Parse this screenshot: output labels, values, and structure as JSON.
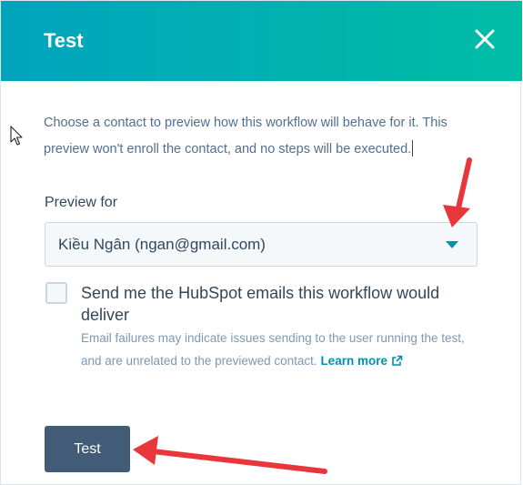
{
  "dialog": {
    "title": "Test",
    "close_icon": "close-icon"
  },
  "description": "Choose a contact to preview how this workflow will behave for it. This preview won't enroll the contact, and no steps will be executed.",
  "preview": {
    "label": "Preview for",
    "selected": "Kiều Ngân (ngan@gmail.com)",
    "dropdown_icon": "caret-down-icon"
  },
  "send_emails": {
    "checked": false,
    "label": "Send me the HubSpot emails this workflow would deliver",
    "help": "Email failures may indicate issues sending to the user running the test, and are unrelated to the previewed contact.",
    "learn_more": "Learn more",
    "learn_more_icon": "external-link-icon"
  },
  "actions": {
    "test_label": "Test"
  },
  "colors": {
    "header_gradient_start": "#00a4bd",
    "header_gradient_end": "#00bda5",
    "button_bg": "#425b76",
    "link": "#0091ae",
    "annotation_arrow": "#e8373b"
  }
}
